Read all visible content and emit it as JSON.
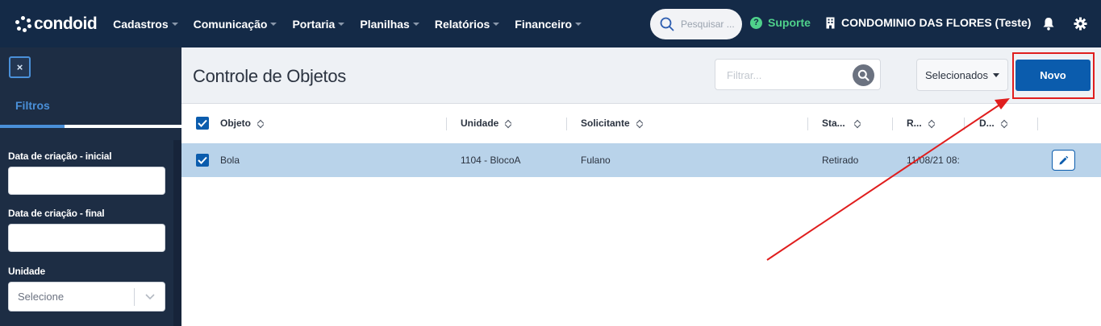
{
  "nav": {
    "logo_text": "condoid",
    "menu": [
      {
        "label": "Cadastros"
      },
      {
        "label": "Comunicação"
      },
      {
        "label": "Portaria"
      },
      {
        "label": "Planilhas"
      },
      {
        "label": "Relatórios"
      },
      {
        "label": "Financeiro"
      }
    ],
    "search_placeholder": "Pesquisar ...",
    "support_label": "Suporte",
    "condo_name": "CONDOMINIO DAS FLORES (Teste)",
    "icons": [
      "search-icon",
      "question-icon",
      "building-icon",
      "bell-icon",
      "gear-icon"
    ]
  },
  "sidebar": {
    "close_label": "×",
    "tab_label": "Filtros",
    "fields": [
      {
        "label": "Data de criação - inicial",
        "value": ""
      },
      {
        "label": "Data de criação - final",
        "value": ""
      }
    ],
    "unit": {
      "label": "Unidade",
      "value": "Selecione"
    }
  },
  "main": {
    "title": "Controle de Objetos",
    "filter_placeholder": "Filtrar...",
    "selected_label": "Selecionados",
    "new_label": "Novo"
  },
  "table": {
    "columns": [
      "Objeto",
      "Unidade",
      "Solicitante",
      "Sta...",
      "R...",
      "D..."
    ],
    "rows": [
      {
        "objeto": "Bola",
        "unidade": "1104 - BlocoA",
        "solicitante": "Fulano",
        "status": "Retirado",
        "r": "11/08/21 08:",
        "d": "",
        "checked": true
      }
    ]
  },
  "colors": {
    "nav_bg": "#142a47",
    "sidebar_bg": "#1d2d44",
    "accent": "#0b5cad",
    "support_green": "#4fd18b",
    "selected_row": "#b9d3ea",
    "annotation_red": "#e01e1e"
  }
}
